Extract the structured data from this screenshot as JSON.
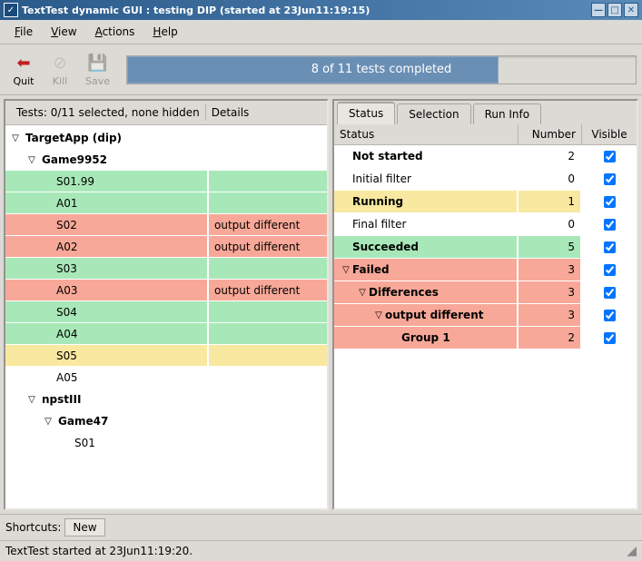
{
  "window": {
    "title": "TextTest dynamic GUI : testing DIP (started at 23Jun11:19:15)"
  },
  "menu": {
    "file": "File",
    "view": "View",
    "actions": "Actions",
    "help": "Help"
  },
  "toolbar": {
    "quit": "Quit",
    "kill": "Kill",
    "save": "Save"
  },
  "progress": {
    "text": "8 of 11 tests completed",
    "percent": 73
  },
  "left": {
    "selection": "Tests: 0/11 selected, none hidden",
    "details": "Details",
    "tree": [
      {
        "indent": 0,
        "toggle": true,
        "bold": true,
        "label": "TargetApp (dip)"
      },
      {
        "indent": 1,
        "toggle": true,
        "bold": true,
        "label": "Game9952"
      }
    ],
    "tests": [
      {
        "indent": 2,
        "name": "S01.99",
        "detail": "",
        "color": "green"
      },
      {
        "indent": 2,
        "name": "A01",
        "detail": "",
        "color": "green"
      },
      {
        "indent": 2,
        "name": "S02",
        "detail": "output different",
        "color": "red"
      },
      {
        "indent": 2,
        "name": "A02",
        "detail": "output different",
        "color": "red"
      },
      {
        "indent": 2,
        "name": "S03",
        "detail": "",
        "color": "green"
      },
      {
        "indent": 2,
        "name": "A03",
        "detail": "output different",
        "color": "red"
      },
      {
        "indent": 2,
        "name": "S04",
        "detail": "",
        "color": "green"
      },
      {
        "indent": 2,
        "name": "A04",
        "detail": "",
        "color": "green"
      },
      {
        "indent": 2,
        "name": "S05",
        "detail": "",
        "color": "yellow"
      },
      {
        "indent": 2,
        "name": "A05",
        "detail": "",
        "color": ""
      }
    ],
    "tree2": [
      {
        "indent": 1,
        "toggle": true,
        "bold": true,
        "label": "npstIII"
      },
      {
        "indent": 2,
        "toggle": true,
        "bold": true,
        "label": "Game47"
      },
      {
        "indent": 3,
        "toggle": false,
        "bold": false,
        "label": "S01"
      }
    ]
  },
  "right": {
    "tabs": {
      "status": "Status",
      "selection": "Selection",
      "runinfo": "Run Info"
    },
    "columns": {
      "status": "Status",
      "number": "Number",
      "visible": "Visible"
    },
    "rows": [
      {
        "indent": 0,
        "toggle": false,
        "bold": true,
        "label": "Not started",
        "number": "2",
        "color": ""
      },
      {
        "indent": 0,
        "toggle": false,
        "bold": false,
        "label": "Initial filter",
        "number": "0",
        "color": ""
      },
      {
        "indent": 0,
        "toggle": false,
        "bold": true,
        "label": "Running",
        "number": "1",
        "color": "yellow"
      },
      {
        "indent": 0,
        "toggle": false,
        "bold": false,
        "label": "Final filter",
        "number": "0",
        "color": ""
      },
      {
        "indent": 0,
        "toggle": false,
        "bold": true,
        "label": "Succeeded",
        "number": "5",
        "color": "green"
      },
      {
        "indent": 0,
        "toggle": true,
        "bold": true,
        "label": "Failed",
        "number": "3",
        "color": "red"
      },
      {
        "indent": 1,
        "toggle": true,
        "bold": true,
        "label": "Differences",
        "number": "3",
        "color": "red"
      },
      {
        "indent": 2,
        "toggle": true,
        "bold": true,
        "label": "output different",
        "number": "3",
        "color": "red"
      },
      {
        "indent": 3,
        "toggle": false,
        "bold": true,
        "label": "Group 1",
        "number": "2",
        "color": "red"
      }
    ]
  },
  "shortcuts": {
    "label": "Shortcuts:",
    "new": "New"
  },
  "statusbar": {
    "text": "TextTest started at 23Jun11:19:20."
  }
}
